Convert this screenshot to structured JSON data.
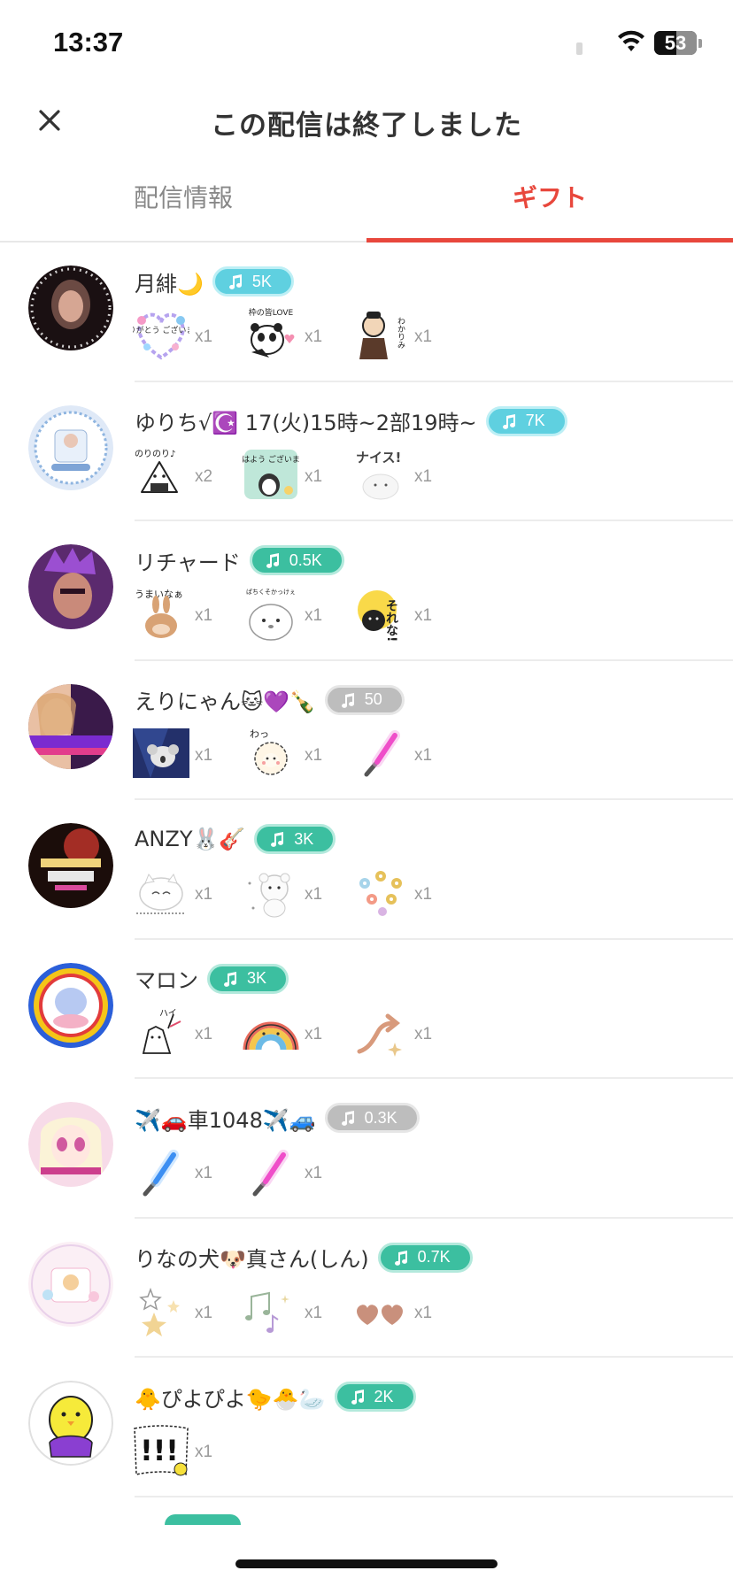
{
  "status_bar": {
    "time": "13:37",
    "battery": "53",
    "battery_level_percent": 53
  },
  "header": {
    "title": "この配信は終了しました"
  },
  "tabs": [
    {
      "label": "配信情報",
      "active": false
    },
    {
      "label": "ギフト",
      "active": true
    }
  ],
  "colors": {
    "accent": "#e8473c",
    "badge_teal": "#3cbfa0",
    "badge_cyan": "#5fd0e0",
    "badge_gray": "#bdbdbd"
  },
  "gifters": [
    {
      "name": "月緋🌙",
      "badge": "5K",
      "badge_color": "cyan",
      "gifts": [
        {
          "icon": "thanks-flower-sticker",
          "count": "x1"
        },
        {
          "icon": "panda-love-sticker",
          "count": "x1"
        },
        {
          "icon": "samurai-understood-sticker",
          "count": "x1"
        }
      ]
    },
    {
      "name": "ゆりち√☪️ 17(火)15時~2部19時~",
      "badge": "7K",
      "badge_color": "cyan",
      "gifts": [
        {
          "icon": "rice-ball-sticker",
          "count": "x2"
        },
        {
          "icon": "penguin-good-morning-sticker",
          "count": "x1"
        },
        {
          "icon": "nice-cat-sticker",
          "count": "x1"
        }
      ]
    },
    {
      "name": "リチャード",
      "badge": "0.5K",
      "badge_color": "teal",
      "gifts": [
        {
          "icon": "rabbit-yummy-sticker",
          "count": "x1"
        },
        {
          "icon": "seal-sticker",
          "count": "x1"
        },
        {
          "icon": "black-cat-sorena-sticker",
          "count": "x1"
        }
      ]
    },
    {
      "name": "えりにゃん🐱💜🍾",
      "badge": "50",
      "badge_color": "gray",
      "gifts": [
        {
          "icon": "koala-sticker",
          "count": "x1"
        },
        {
          "icon": "sheep-sticker",
          "count": "x1"
        },
        {
          "icon": "pink-glowstick",
          "count": "x1"
        }
      ]
    },
    {
      "name": "ANZY🐰🎸",
      "badge": "3K",
      "badge_color": "teal",
      "gifts": [
        {
          "icon": "white-cat-sticker",
          "count": "x1"
        },
        {
          "icon": "white-bear-sticker",
          "count": "x1"
        },
        {
          "icon": "flowers-sticker",
          "count": "x1"
        }
      ]
    },
    {
      "name": "マロン",
      "badge": "3K",
      "badge_color": "teal",
      "gifts": [
        {
          "icon": "waving-cat-sticker",
          "count": "x1"
        },
        {
          "icon": "rainbow-sticker",
          "count": "x1"
        },
        {
          "icon": "arrow-sparkle-sticker",
          "count": "x1"
        }
      ]
    },
    {
      "name": "✈️🚗車1048✈️🚙",
      "badge": "0.3K",
      "badge_color": "gray",
      "gifts": [
        {
          "icon": "blue-glowstick",
          "count": "x1"
        },
        {
          "icon": "pink-glowstick",
          "count": "x1"
        }
      ]
    },
    {
      "name": "りなの犬🐶真さん(しん)",
      "badge": "0.7K",
      "badge_color": "teal",
      "gifts": [
        {
          "icon": "stars-sticker",
          "count": "x1"
        },
        {
          "icon": "music-notes-sticker",
          "count": "x1"
        },
        {
          "icon": "hearts-sticker",
          "count": "x1"
        }
      ]
    },
    {
      "name": "🐥ぴよぴよ🐤🐣🦢",
      "badge": "2K",
      "badge_color": "teal",
      "gifts": [
        {
          "icon": "exclamation-chick-sticker",
          "count": "x1"
        }
      ]
    }
  ],
  "sticker_text": {
    "thanks": "ありがとう ございます",
    "panda": "枠の皆LOVE",
    "samurai": "わかりみ",
    "rice": "のりのり♪",
    "morning": "おはよう ございます",
    "nice": "ナイス!",
    "rabbit": "うまいなぁ",
    "seal": "ぱちくそかっけぇ",
    "sorena": "それな!!",
    "sheep": "わっ",
    "wave": "ハイ",
    "excl": "!!!"
  }
}
